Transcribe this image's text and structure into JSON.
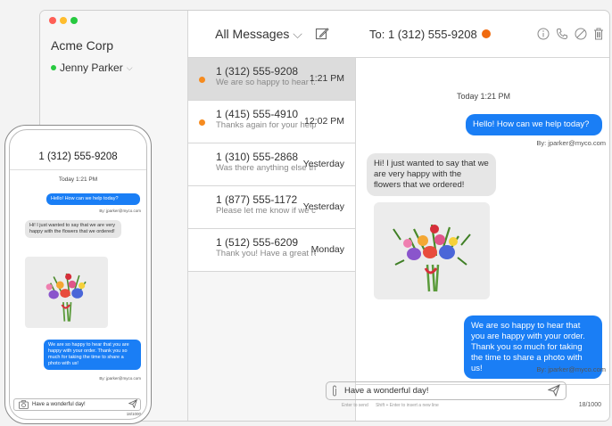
{
  "colors": {
    "accent": "#1a7ef5",
    "unread": "#f68b1f",
    "online": "#27c93f",
    "red": "#ff5f56",
    "yellow": "#ffbd2e",
    "green": "#27c93f"
  },
  "sidebar": {
    "org": "Acme Corp",
    "user": "Jenny Parker"
  },
  "list": {
    "title": "All Messages",
    "conversations": [
      {
        "number": "1 (312) 555-9208",
        "preview": "We are so happy to hear t...",
        "time": "1:21 PM",
        "unread": true
      },
      {
        "number": "1 (415) 555-4910",
        "preview": "Thanks again for your help...",
        "time": "12:02 PM",
        "unread": true
      },
      {
        "number": "1 (310) 555-2868",
        "preview": "Was there anything else th...",
        "time": "Yesterday",
        "unread": false
      },
      {
        "number": "1 (877) 555-1172",
        "preview": "Please let me know if we c...",
        "time": "Yesterday",
        "unread": false
      },
      {
        "number": "1 (512) 555-6209",
        "preview": "Thank you! Have a great re...",
        "time": "Monday",
        "unread": false
      }
    ]
  },
  "chat": {
    "to": "To: 1 (312) 555-9208",
    "day": "Today 1:21 PM",
    "msg1": "Hello! How can we help today?",
    "sig1": "By: jparker@myco.com",
    "msg2": "Hi! I just wanted to say that we are very happy with the flowers that we ordered!",
    "image": "flower-bouquet",
    "msg3": "We are so happy to hear that you are happy with your order. Thank you so much for taking the time to share a photo with us!",
    "sig3": "By: jparker@myco.com",
    "composer": "Have a wonderful day!",
    "hint_send": "Enter to send",
    "hint_newline": "Shift + Enter to insert a new line",
    "count": "18/1000"
  },
  "phone": {
    "title": "1 (312) 555-9208",
    "day": "Today 1:21 PM",
    "msg1": "Hello! How can we help today?",
    "sig1": "By: jparker@myco.com",
    "msg2": "Hi! I just wanted to say that we are very happy with the flowers that we ordered!",
    "msg3": "We are so happy to hear that you are happy with your order. Thank you so much for taking the time to share a photo with us!",
    "sig3": "By: jparker@myco.com",
    "composer": "Have a wonderful day!",
    "count": "18/1000"
  }
}
